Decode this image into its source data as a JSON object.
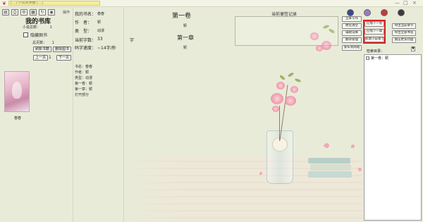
{
  "titlebar": {
    "title": "[…] 小说阅读器 […]",
    "minimize": "—",
    "maximize": "□",
    "close": "×"
  },
  "toolbar": {
    "icons": [
      "open-book-icon",
      "printer-icon",
      "settings-icon",
      "grid-icon",
      "refresh-icon",
      "record-icon"
    ],
    "action_label": "操作"
  },
  "library": {
    "title": "我的书库",
    "novel_count_label": "小说总数：",
    "novel_count": "1",
    "hide_books_label": "隐藏图书",
    "total_pages_label": "总页数：",
    "total_pages": "1",
    "refresh_button": "刷新书籍",
    "delete_button": "删除图书",
    "prev_page": "上一页",
    "page_no": "1",
    "next_page": "下一页",
    "book_name": "春春"
  },
  "info": {
    "book_name_label": "我的书名：",
    "book_name": "春春",
    "author_label": "作　者：",
    "author": "颖",
    "type_label": "类　型：",
    "type": "动漫",
    "word_count_label": "当前字数：",
    "word_count": "33",
    "word_unit": "字",
    "speed_label": "码字速度：",
    "speed": "~14字/秒",
    "meta": [
      "书名：春春",
      "作者：颖",
      "类型：动漫",
      "第一卷：颖",
      "第一章：颖",
      "打开部分"
    ]
  },
  "reading": {
    "volume_title": "第一卷",
    "volume_sub": "颖",
    "chapter_title": "第一章",
    "chapter_sub": "颖"
  },
  "bookmark": {
    "title": "当前便签记录"
  },
  "right_buttons": {
    "col1": [
      "全屏写作",
      "便签清空",
      "辅助词库",
      "翻译管理",
      "发布到网站"
    ],
    "col2_highlighted": [
      "在线下一卷",
      "在线下一章",
      "新建小说章节"
    ],
    "col3": [
      "导出当前章节",
      "导出全部书名",
      "施压更多封面"
    ],
    "lookup_label": "检索目录：",
    "scroll_down": "▼"
  },
  "chapter_tree": {
    "item": "第一卷：颖",
    "expander": "−"
  }
}
